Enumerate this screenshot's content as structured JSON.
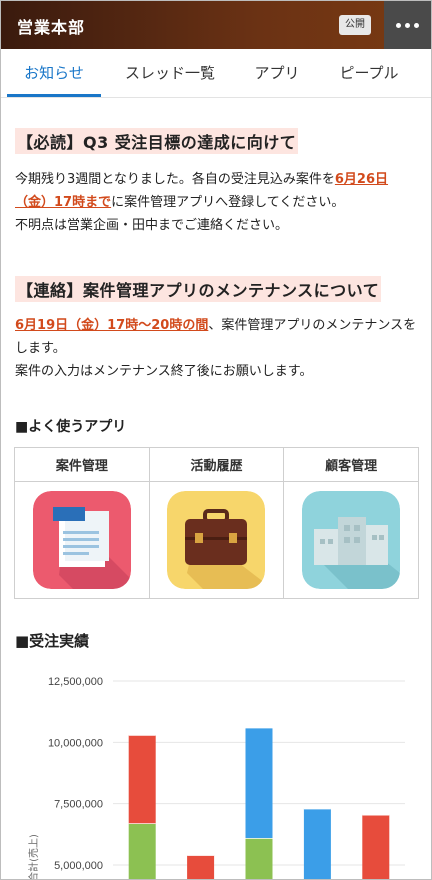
{
  "header": {
    "title": "営業本部",
    "badge": "公開"
  },
  "tabs": [
    {
      "label": "お知らせ",
      "active": true
    },
    {
      "label": "スレッド一覧",
      "active": false
    },
    {
      "label": "アプリ",
      "active": false
    },
    {
      "label": "ピープル",
      "active": false
    }
  ],
  "notices": [
    {
      "title": "【必読】Q3 受注目標の達成に向けて",
      "line1_before": "今期残り3週間となりました。各自の受注見込み案件を",
      "line1_highlight": "6月26日（金）17時まで",
      "line1_after": "に案件管理アプリへ登録してください。",
      "line2": "不明点は営業企画・田中までご連絡ください。"
    },
    {
      "title": "【連絡】案件管理アプリのメンテナンスについて",
      "line1_highlight": "6月19日（金）17時〜20時の間",
      "line1_after": "、案件管理アプリのメンテナンスをします。",
      "line2": "案件の入力はメンテナンス終了後にお願いします。"
    }
  ],
  "apps_section": {
    "title": "■よく使うアプリ",
    "apps": [
      {
        "label": "案件管理",
        "icon": "document-icon"
      },
      {
        "label": "活動履歴",
        "icon": "briefcase-icon"
      },
      {
        "label": "顧客管理",
        "icon": "buildings-icon"
      }
    ]
  },
  "chart_section": {
    "title": "■受注実績"
  },
  "chart_data": {
    "type": "bar",
    "stacked": true,
    "ylabel": "合計(売上)",
    "ylim": [
      4800000,
      13000000
    ],
    "yticks": [
      "12,500,000",
      "10,000,000",
      "7,500,000",
      "5,000,000"
    ],
    "ytick_values": [
      12500000,
      10000000,
      7500000,
      5000000
    ],
    "bars": [
      {
        "segments": [
          {
            "value": 6700000,
            "color": "#8cc152"
          },
          {
            "value": 3600000,
            "color": "#e74c3c"
          }
        ]
      },
      {
        "segments": [
          {
            "value": 5400000,
            "color": "#e74c3c"
          }
        ]
      },
      {
        "segments": [
          {
            "value": 6100000,
            "color": "#8cc152"
          },
          {
            "value": 4500000,
            "color": "#3b9ee8"
          }
        ]
      },
      {
        "segments": [
          {
            "value": 7300000,
            "color": "#3b9ee8"
          }
        ]
      },
      {
        "segments": [
          {
            "value": 7050000,
            "color": "#e74c3c"
          }
        ]
      }
    ],
    "grid": true
  }
}
